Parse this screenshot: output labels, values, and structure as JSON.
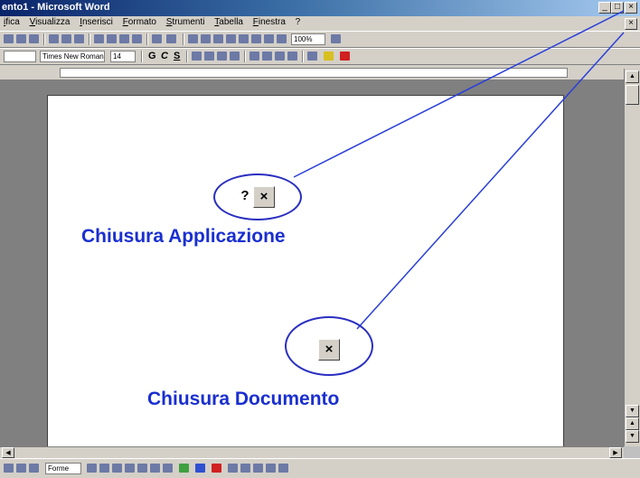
{
  "window": {
    "title": "ento1 - Microsoft Word",
    "buttons": {
      "minimize": "_",
      "maximize": "□",
      "close": "×"
    }
  },
  "menubar": {
    "items": [
      "ifica",
      "Visualizza",
      "Inserisci",
      "Formato",
      "Strumenti",
      "Tabella",
      "Finestra",
      "?"
    ]
  },
  "document_controls": {
    "close": "×"
  },
  "toolbar_standard": {
    "zoom": "100%"
  },
  "toolbar_format": {
    "style": "",
    "font": "Times New Roman",
    "size": "14",
    "bold": "G",
    "italic": "C",
    "underline": "S"
  },
  "drawbar": {
    "shapes_label": "Forme"
  },
  "annotations": {
    "app_close_label": "Chiusura Applicazione",
    "app_close_glyphs": {
      "help": "?",
      "close": "×"
    },
    "doc_close_label": "Chiusura Documento",
    "doc_close_glyph": "×",
    "line_color": "#2a3fd8"
  },
  "colors": {
    "titlebar_start": "#0a246a",
    "titlebar_end": "#a6caf0",
    "callout_text": "#1a2fd0",
    "workspace": "#808080"
  }
}
